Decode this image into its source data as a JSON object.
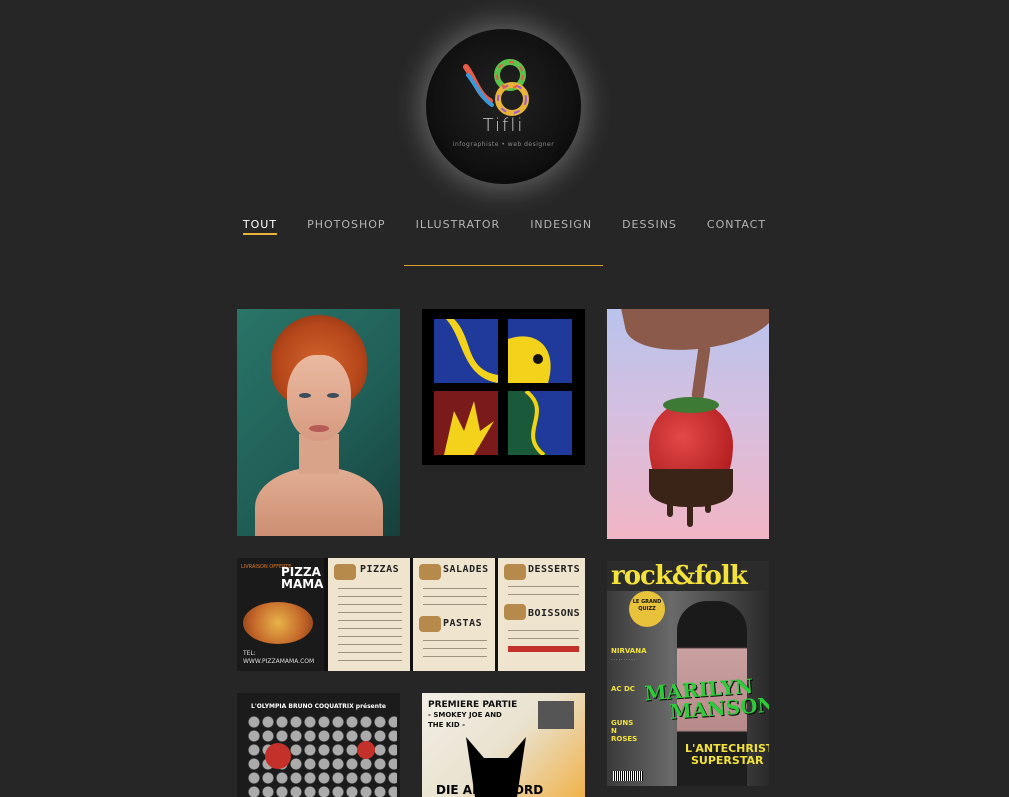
{
  "logo": {
    "title": "Tifli",
    "subtitle": "infographiste • web designer"
  },
  "nav": {
    "items": [
      {
        "label": "TOUT",
        "active": true
      },
      {
        "label": "PHOTOSHOP",
        "active": false
      },
      {
        "label": "ILLUSTRATOR",
        "active": false
      },
      {
        "label": "INDESIGN",
        "active": false
      },
      {
        "label": "DESSINS",
        "active": false
      },
      {
        "label": "CONTACT",
        "active": false
      }
    ]
  },
  "colors": {
    "background": "#262626",
    "accent": "#e8b43a",
    "nav_text": "#b4b4b4"
  },
  "portfolio": {
    "menu": {
      "cover_offer": "LIVRAISON OFFERTE",
      "cover_title_line1": "PIZZA",
      "cover_title_line2": "MAMA",
      "cover_tel": "TEL:",
      "cover_url": "WWW.PIZZAMAMA.COM",
      "section_pizzas": "PIZZAS",
      "section_salades": "SALADES",
      "section_pastas": "PASTAS",
      "section_desserts": "DESSERTS",
      "section_boissons": "BOISSONS"
    },
    "magazine": {
      "masthead": "rock&folk",
      "badge": "LE GRAND QUIZZ",
      "side1": "NIRVANA",
      "side2": "AC DC",
      "side3": "GUNS N ROSES",
      "headline_line1": "MARILYN",
      "headline_line2": "MANSON",
      "sub_line1": "L'ANTECHRIST",
      "sub_line2": "SUPERSTAR"
    },
    "poster1": {
      "header": "L'OLYMPIA BRUNO COQUATRIX présente"
    },
    "poster2": {
      "header_line1": "PREMIERE PARTIE",
      "header_line2": "- SMOKEY JOE AND",
      "header_line3": "THE KID -",
      "bottom": "DIE ANTWOORD"
    }
  }
}
